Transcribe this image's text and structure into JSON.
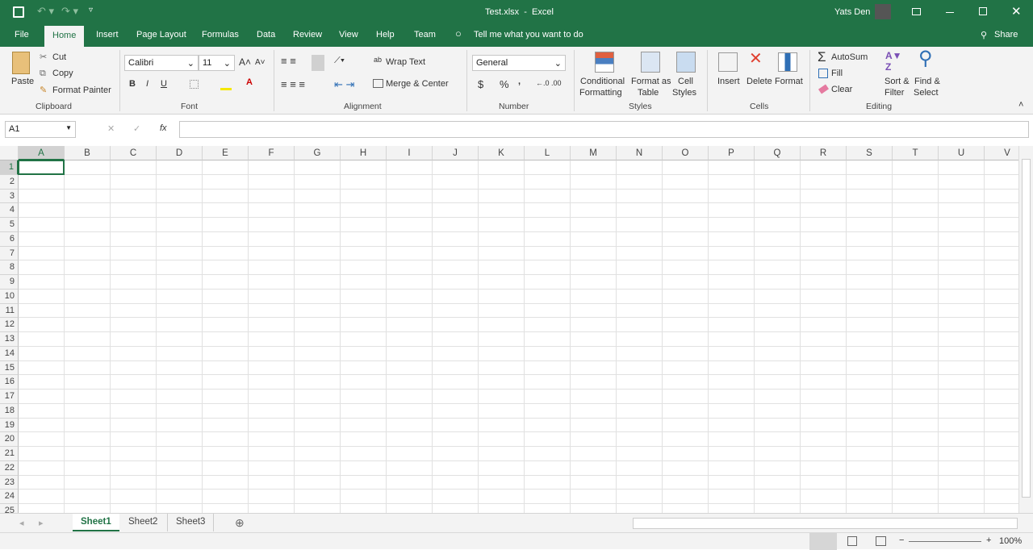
{
  "title": {
    "doc": "Test.xlsx  -  Excel",
    "user": "Yats Den"
  },
  "tabs": [
    "File",
    "Home",
    "Insert",
    "Page Layout",
    "Formulas",
    "Data",
    "Review",
    "View",
    "Help",
    "Team"
  ],
  "tell_me": "Tell me what you want to do",
  "share": "Share",
  "clipboard": {
    "paste": "Paste",
    "cut": "Cut",
    "copy": "Copy",
    "format_painter": "Format Painter",
    "label": "Clipboard"
  },
  "font": {
    "name": "Calibri",
    "size": "11",
    "bold": "B",
    "italic": "I",
    "underline": "U",
    "label": "Font"
  },
  "alignment": {
    "wrap": "Wrap Text",
    "merge": "Merge & Center",
    "label": "Alignment"
  },
  "number": {
    "format": "General",
    "currency": "$",
    "percent": "%",
    "comma": ",",
    "label": "Number"
  },
  "styles": {
    "cond1": "Conditional",
    "cond2": "Formatting",
    "fat1": "Format as",
    "fat2": "Table",
    "cs1": "Cell",
    "cs2": "Styles",
    "label": "Styles"
  },
  "cells": {
    "insert": "Insert",
    "delete": "Delete",
    "format": "Format",
    "label": "Cells"
  },
  "editing": {
    "autosum": "AutoSum",
    "fill": "Fill",
    "clear": "Clear",
    "sort1": "Sort &",
    "sort2": "Filter",
    "find1": "Find &",
    "find2": "Select",
    "label": "Editing"
  },
  "formula_bar": {
    "name_box": "A1",
    "fx": "fx",
    "value": ""
  },
  "columns": [
    "A",
    "B",
    "C",
    "D",
    "E",
    "F",
    "G",
    "H",
    "I",
    "J",
    "K",
    "L",
    "M",
    "N",
    "O",
    "P",
    "Q",
    "R",
    "S",
    "T",
    "U",
    "V"
  ],
  "rows": [
    "1",
    "2",
    "3",
    "4",
    "5",
    "6",
    "7",
    "8",
    "9",
    "10",
    "11",
    "12",
    "13",
    "14",
    "15",
    "16",
    "17",
    "18",
    "19",
    "20",
    "21",
    "22",
    "23",
    "24",
    "25"
  ],
  "sheets": [
    "Sheet1",
    "Sheet2",
    "Sheet3"
  ],
  "active_sheet": "Sheet1",
  "zoom": "100%"
}
